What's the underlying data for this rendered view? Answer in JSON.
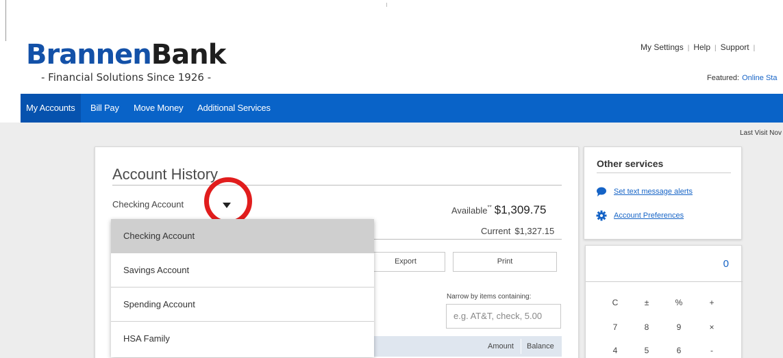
{
  "header": {
    "logo_part1": "Brannen",
    "logo_part2": "Bank",
    "tagline": "- Financial Solutions Since 1926 -",
    "util_links": [
      "My Settings",
      "Help",
      "Support"
    ],
    "featured_label": "Featured:",
    "featured_link": "Online Sta"
  },
  "nav": {
    "items": [
      "My Accounts",
      "Bill Pay",
      "Move Money",
      "Additional Services"
    ]
  },
  "last_visit": "Last Visit Nov",
  "account_history": {
    "title": "Account History",
    "selected_account": "Checking Account",
    "available_label": "Available",
    "available_marker": "**",
    "available_amount": "$1,309.75",
    "current_label": "Current",
    "current_amount": "$1,327.15",
    "export_label": "Export",
    "print_label": "Print",
    "narrow_label": "Narrow by items containing:",
    "narrow_placeholder": "e.g. AT&T, check, 5.00",
    "col_amount": "Amount",
    "col_balance": "Balance"
  },
  "account_dropdown": {
    "options": [
      "Checking Account",
      "Savings Account",
      "Spending Account",
      "HSA Family"
    ],
    "selected_index": 0
  },
  "other_services": {
    "title": "Other services",
    "link_alerts": "Set text message alerts",
    "link_prefs": "Account Preferences"
  },
  "calculator": {
    "display": "0",
    "keys": [
      [
        "C",
        "±",
        "%",
        "+"
      ],
      [
        "7",
        "8",
        "9",
        "×"
      ],
      [
        "4",
        "5",
        "6",
        "-"
      ]
    ]
  },
  "colors": {
    "brand_blue": "#1351a8",
    "nav_blue": "#0963c8",
    "link_blue": "#1563c6",
    "highlight_red": "#e11d1d"
  }
}
